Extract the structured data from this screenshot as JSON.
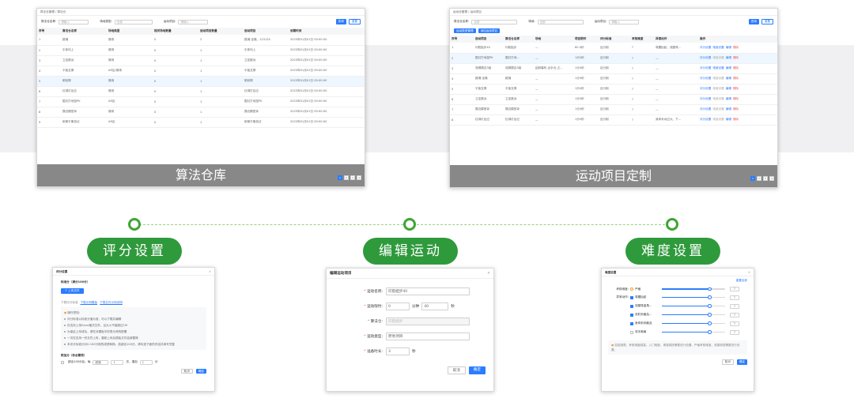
{
  "shot1": {
    "breadcrumb": "算法仓管理 / 算法仓",
    "filters": [
      {
        "label": "算法仓名称:",
        "placeholder": "请输入"
      },
      {
        "label": "场地类型:",
        "placeholder": "全部"
      },
      {
        "label": "运动项目:",
        "placeholder": "请输入"
      }
    ],
    "query": "查询",
    "reset": "重置",
    "columns": [
      "序号",
      "算法仓名称",
      "场地类型",
      "相关场地数量",
      "运动项目数量",
      "运动项目",
      "到期时间"
    ],
    "rows": [
      [
        "1",
        "跳绳",
        "操场",
        "0",
        "2",
        "跳绳·坐绳，123124",
        "2023年01月01日 00:00:00"
      ],
      [
        "2",
        "引体向上",
        "操场",
        "0",
        "1",
        "引体向上",
        "2023年01月01日 00:00:00"
      ],
      [
        "3",
        "立定跳远",
        "操场",
        "0",
        "1",
        "立定跳远",
        "2023年01月01日 00:00:00"
      ],
      [
        "4",
        "平板支撑",
        "AR区/操场",
        "0",
        "1",
        "平板支撑",
        "2023年01月01日 00:00:00"
      ],
      [
        "5",
        "俯卧撑",
        "操场",
        "0",
        "1",
        "俯卧撑",
        "2023年01月01日 00:00:00"
      ],
      [
        "6",
        "红绿灯反应",
        "操场",
        "0",
        "1",
        "红绿灯反应",
        "2023年01月01日 00:00:00"
      ],
      [
        "7",
        "掘幻打地鼠PK",
        "AR区",
        "0",
        "1",
        "掘幻打地鼠PK",
        "2023年01月01日 00:00:00"
      ],
      [
        "8",
        "摸边模型拿",
        "操场",
        "0",
        "1",
        "摸边模型拿",
        "2023年01月01日 00:00:00"
      ],
      [
        "9",
        "射箭平衡游泛",
        "AR区",
        "0",
        "1",
        "射箭平衡游泛",
        "2023年01月01日 00:00:00"
      ]
    ],
    "overlay": "算法仓库",
    "pager": [
      "1",
      "2",
      "3",
      "4"
    ]
  },
  "shot2": {
    "breadcrumb": "运动仓管理 / 运动项目",
    "filters": [
      {
        "label": "算法仓名称:",
        "placeholder": "全部"
      },
      {
        "label": "场地:",
        "placeholder": "全部"
      },
      {
        "label": "运动项目:",
        "placeholder": "请输入"
      }
    ],
    "query": "查询",
    "reset": "重置",
    "actions": [
      "运动类型管理",
      "添加运动项目"
    ],
    "columns": [
      "序号",
      "运动项目",
      "算法仓名称",
      "场地",
      "项目限时",
      "评分标准",
      "考核难度",
      "异常动作",
      "操作"
    ],
    "rows": [
      [
        "1",
        "印肌姐步40",
        "印肌姐步",
        "—",
        "60.0秒",
        "百分制",
        "?",
        "弯腰抬起，双腿弯...",
        true
      ],
      [
        "2",
        "掘幻打地鼠PK",
        "掘幻打地...",
        "—",
        "1分0秒",
        "百分制",
        "?",
        "—",
        false
      ],
      [
        "3",
        "双脚摸边3组",
        "双脚摸边3组",
        "起跃幕布,出手仓,占…",
        "1分0秒",
        "百分制",
        "?",
        "—",
        true
      ],
      [
        "4",
        "跳绳·坐绳",
        "跳绳",
        "—",
        "1分0秒",
        "百分制",
        "?",
        "—",
        false
      ],
      [
        "5",
        "平板支撑",
        "平板支撑",
        "—",
        "1分0秒",
        "百分制",
        "?",
        "—",
        false
      ],
      [
        "6",
        "立定跳远",
        "立定跳远",
        "—",
        "1分0秒",
        "百分制",
        "?",
        "—",
        false
      ],
      [
        "7",
        "摸边模型拿",
        "摸边模型拿",
        "—",
        "1分0秒",
        "百分制",
        "?",
        "—",
        false
      ],
      [
        "8",
        "红绿灯反应",
        "红绿灯反应",
        "—",
        "1分0秒",
        "百分制",
        "?",
        "身体未动过大、下...",
        false
      ]
    ],
    "ops": [
      "评分设置",
      "难度设置",
      "编辑",
      "删除"
    ],
    "overlay": "运动项目定制",
    "pager": [
      "1",
      "2",
      "3",
      "4"
    ]
  },
  "pills": [
    "评分设置",
    "编辑运动",
    "难度设置"
  ],
  "score_dialog": {
    "title": "评分设置",
    "std_label": "标准分（满分100分）",
    "upload": "上传文件",
    "links": [
      "下载评分标准",
      "下载示例模板",
      "下载文件示例说明"
    ],
    "tip_head": "操作须知:",
    "tips": [
      "评分标准以标准分值为准，可以下载并编辑",
      "仅支持上传Excel格式文件，且大小不能超过1M",
      "为保证上传成功，请在对模板中的表头修改配置",
      "一次仅支持一份文件上传，重新上传后原始文件会被替换",
      "本评分标准针对0-100分制的成绩转换，若超出100分，请勾选下面的内容并填写完整"
    ],
    "extra_label": "附加分（非必需项）",
    "extra_row": [
      "超出100分后，每",
      "超绳",
      "1",
      "次，增加",
      "1",
      "分"
    ],
    "cancel": "取消",
    "ok": "确定"
  },
  "edit_dialog": {
    "title": "编辑运动项目",
    "f_name": "运动名称:",
    "v_name": "印肌姐步40",
    "f_time": "运动限时:",
    "v_min": "0",
    "u_min": "分钟",
    "v_sec": "40",
    "u_sec": "秒",
    "f_algo": "算法仓:",
    "v_algo": "印肌姐步",
    "f_type": "运动类型:",
    "v_type": "原地项目",
    "f_prep": "准备时长:",
    "v_prep": "3",
    "u_prep": "秒",
    "cancel": "取消",
    "ok": "确定"
  },
  "diff_dialog": {
    "title": "难度设置",
    "restore": "重置全部",
    "level_label": "考核难度:",
    "level_value": "严格",
    "abn_label": "异常动作:",
    "items": [
      {
        "label": "弯腰抬起",
        "checked": true,
        "level": 0.75
      },
      {
        "label": "双腿弯曲角...",
        "checked": true,
        "level": 0.75
      },
      {
        "label": "双肘未触及...",
        "checked": true,
        "level": 0.75
      },
      {
        "label": "身体前未触及",
        "checked": true,
        "level": 0.75
      },
      {
        "label": "双手离肩",
        "checked": false,
        "level": 0.75
      }
    ],
    "q": "?",
    "note": "如若超限，考核难度越高，入门难度，请谨慎按需要进行设置。严格考核难度，请谨慎按需要进行设置。",
    "cancel": "取消",
    "ok": "确定"
  }
}
